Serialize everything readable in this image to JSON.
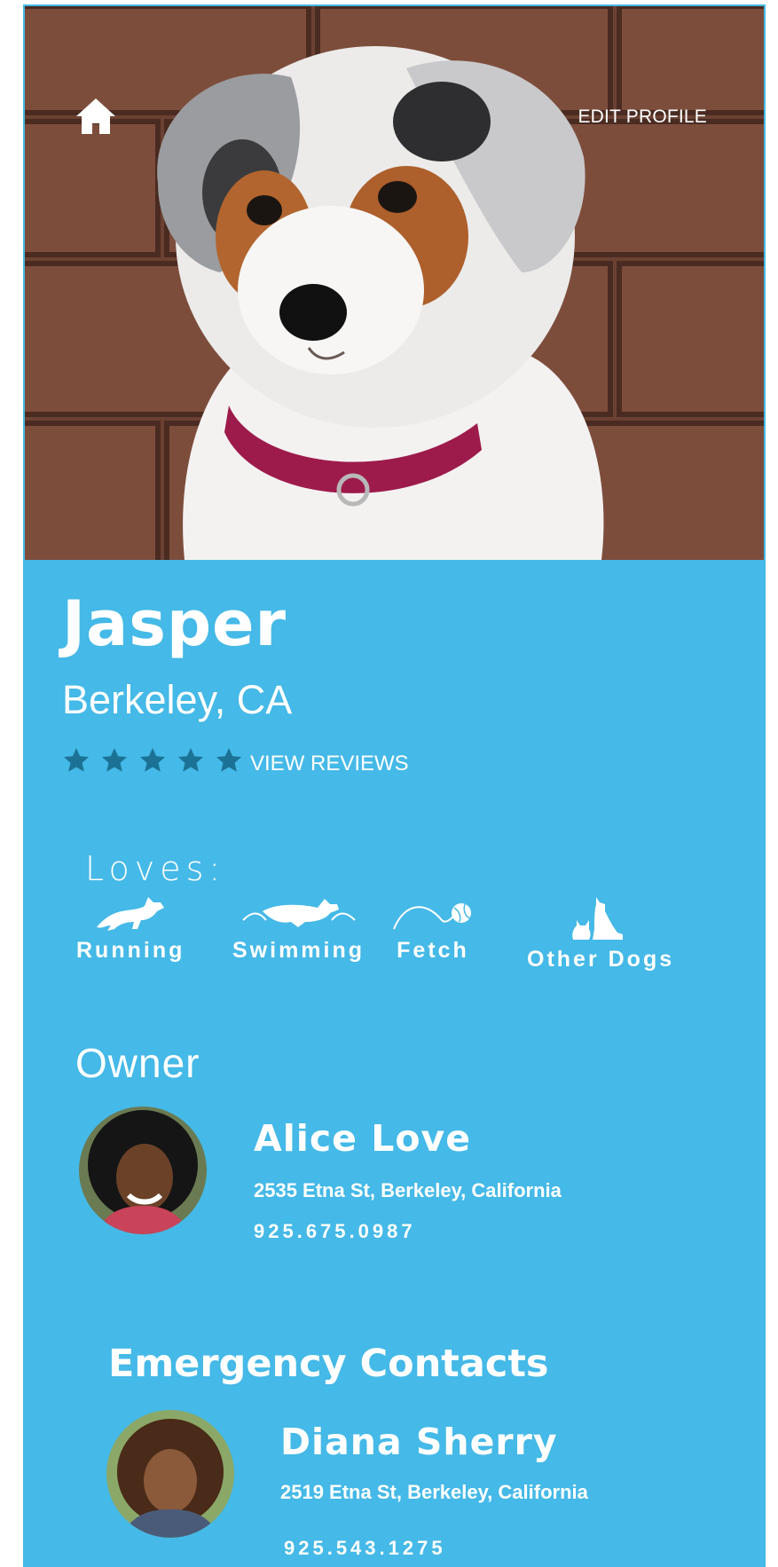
{
  "header": {
    "home_icon": "home-icon",
    "edit_label": "EDIT PROFILE"
  },
  "dog": {
    "name": "Jasper",
    "location": "Berkeley, CA",
    "rating": 5,
    "rating_max": 5,
    "reviews_label": "VIEW REVIEWS"
  },
  "loves": {
    "heading": "Loves:",
    "items": [
      {
        "label": "Running",
        "icon": "running-dog-icon"
      },
      {
        "label": "Swimming",
        "icon": "swimming-dog-icon"
      },
      {
        "label": "Fetch",
        "icon": "fetch-ball-icon"
      },
      {
        "label": "Other Dogs",
        "icon": "dog-and-cat-icon"
      }
    ]
  },
  "owner": {
    "heading": "Owner",
    "name": "Alice Love",
    "address": "2535 Etna St, Berkeley, California",
    "phone": "925.675.0987"
  },
  "emergency": {
    "heading": "Emergency Contacts",
    "contacts": [
      {
        "name": "Diana Sherry",
        "address": "2519 Etna St, Berkeley, California",
        "phone": "925.543.1275"
      }
    ]
  },
  "colors": {
    "background": "#45b9e7",
    "star": "#1b7294",
    "text": "#ffffff"
  }
}
